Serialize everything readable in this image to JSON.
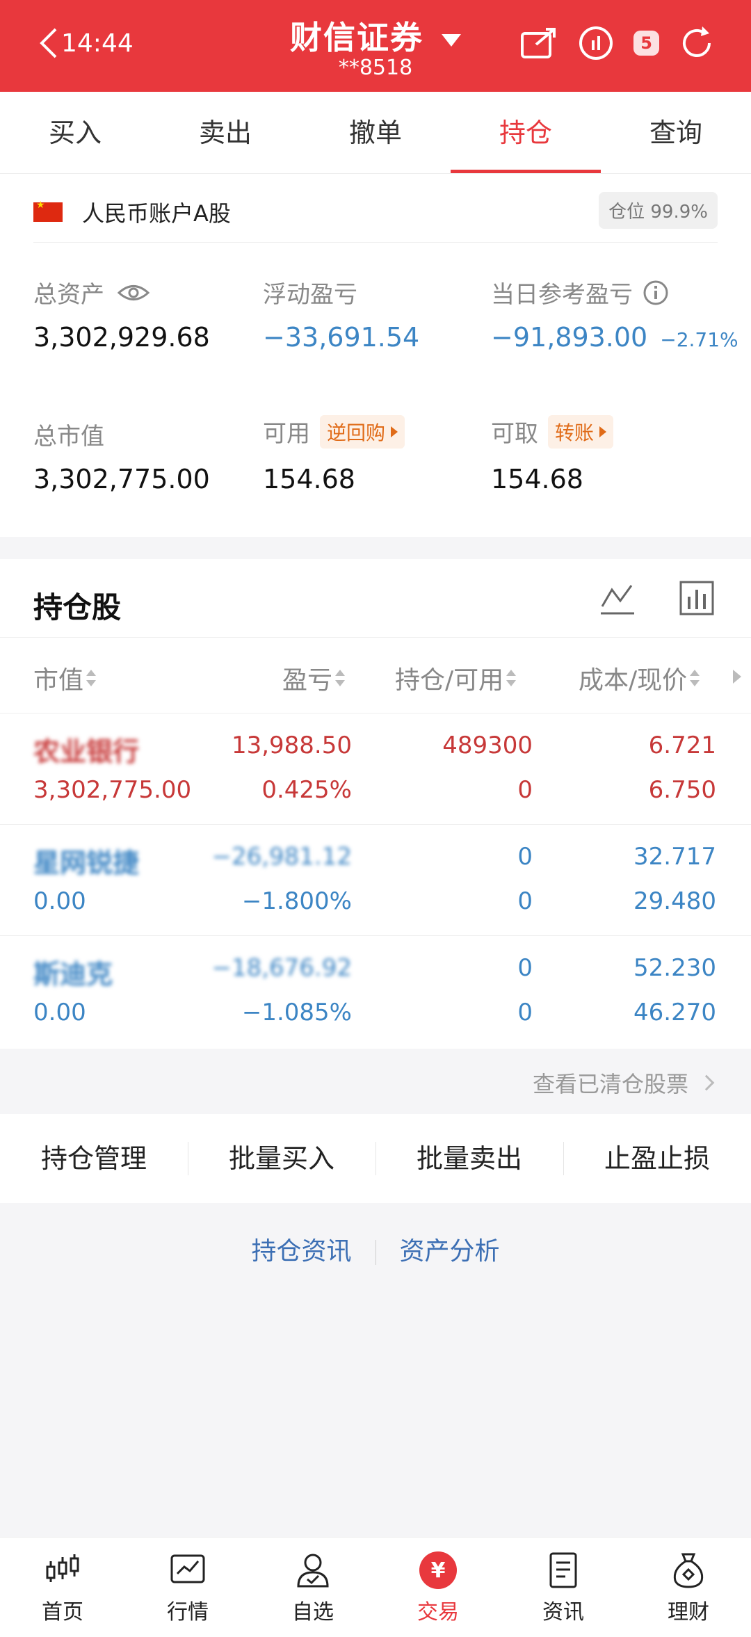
{
  "status": {
    "time": "14:44",
    "battery": "5"
  },
  "header": {
    "title": "财信证券",
    "account": "**8518"
  },
  "tabs": [
    {
      "label": "买入"
    },
    {
      "label": "卖出"
    },
    {
      "label": "撤单"
    },
    {
      "label": "持仓",
      "active": true
    },
    {
      "label": "查询"
    }
  ],
  "account_summary": {
    "account_type": "人民币账户A股",
    "position_ratio": "仓位 99.9%",
    "total_assets_label": "总资产",
    "total_assets": "3,302,929.68",
    "floating_pl_label": "浮动盈亏",
    "floating_pl": "−33,691.54",
    "daily_pl_label": "当日参考盈亏",
    "daily_pl": "−91,893.00",
    "daily_pl_pct": "−2.71%",
    "market_value_label": "总市值",
    "market_value": "3,302,775.00",
    "available_label": "可用",
    "available": "154.68",
    "reverse_repo_label": "逆回购",
    "withdrawable_label": "可取",
    "withdrawable": "154.68",
    "transfer_label": "转账"
  },
  "holdings": {
    "title": "持仓股",
    "columns": [
      "市值",
      "盈亏",
      "持仓/可用",
      "成本/现价"
    ],
    "rows": [
      {
        "name": "农业银行",
        "market_value": "3,302,775.00",
        "pl": "13,988.50",
        "pl_pct": "0.425%",
        "position": "489300",
        "available": "0",
        "cost": "6.721",
        "price": "6.750",
        "color": "#c73838"
      },
      {
        "name": "星网锐捷",
        "market_value": "0.00",
        "pl": "−26,981.12",
        "pl_pct": "−1.800%",
        "position": "0",
        "available": "0",
        "cost": "32.717",
        "price": "29.480",
        "color": "#3c85c4"
      },
      {
        "name": "斯迪克",
        "market_value": "0.00",
        "pl": "−18,676.92",
        "pl_pct": "−1.085%",
        "position": "0",
        "available": "0",
        "cost": "52.230",
        "price": "46.270",
        "color": "#3c85c4"
      }
    ],
    "cleared_link": "查看已清仓股票"
  },
  "actions": [
    "持仓管理",
    "批量买入",
    "批量卖出",
    "止盈止损"
  ],
  "links": [
    "持仓资讯",
    "资产分析"
  ],
  "bottom_nav": [
    {
      "label": "首页",
      "icon": "candlestick-icon"
    },
    {
      "label": "行情",
      "icon": "chart-icon"
    },
    {
      "label": "自选",
      "icon": "user-check-icon"
    },
    {
      "label": "交易",
      "icon": "yen-icon",
      "active": true
    },
    {
      "label": "资讯",
      "icon": "document-icon"
    },
    {
      "label": "理财",
      "icon": "money-bag-icon"
    }
  ],
  "colors": {
    "brand": "#e8383d",
    "gain": "#c73838",
    "loss": "#3c85c4",
    "link": "#3c6fb4"
  }
}
